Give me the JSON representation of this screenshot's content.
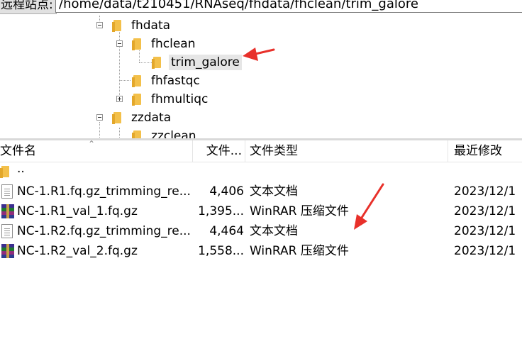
{
  "pathbar": {
    "site_label": "远程站点:",
    "path_value": "/home/data/t210451/RNAseq/fhdata/fhclean/trim_galore"
  },
  "tree": {
    "fhdata": "fhdata",
    "fhclean": "fhclean",
    "trim_galore": "trim_galore",
    "fhfastqc": "fhfastqc",
    "fhmultiqc": "fhmultiqc",
    "zzdata": "zzdata",
    "zzclean": "zzclean"
  },
  "list": {
    "headers": {
      "name": "文件名",
      "size": "文件...",
      "type": "文件类型",
      "modified": "最近修改"
    },
    "parent_dir": "..",
    "rows": [
      {
        "name": "NC-1.R1.fq.gz_trimming_re...",
        "size": "4,406",
        "type": "文本文档",
        "modified": "2023/12/1",
        "icon": "text-file-icon"
      },
      {
        "name": "NC-1.R1_val_1.fq.gz",
        "size": "1,395...",
        "type": "WinRAR 压缩文件",
        "modified": "2023/12/1",
        "icon": "winrar-archive-icon"
      },
      {
        "name": "NC-1.R2.fq.gz_trimming_re...",
        "size": "4,464",
        "type": "文本文档",
        "modified": "2023/12/1",
        "icon": "text-file-icon"
      },
      {
        "name": "NC-1.R2_val_2.fq.gz",
        "size": "1,558...",
        "type": "WinRAR 压缩文件",
        "modified": "2023/12/1",
        "icon": "winrar-archive-icon"
      }
    ]
  },
  "annotation_color": "#e8302a"
}
